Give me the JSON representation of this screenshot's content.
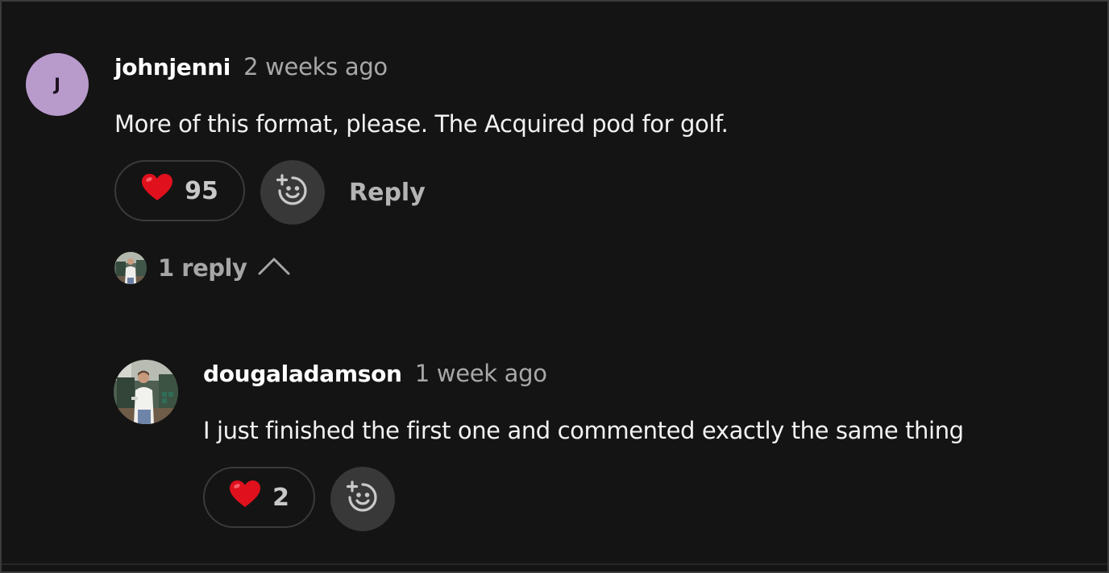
{
  "comments": [
    {
      "avatar_letter": "J",
      "avatar_color": "#b89acb",
      "username": "johnjenni",
      "timestamp": "2 weeks ago",
      "text": "More of this format, please. The Acquired pod for golf.",
      "like_emoji": "❤️",
      "like_count": "95",
      "reply_label": "Reply",
      "replies_toggle": {
        "label": "1 reply",
        "icon": "chevron-up-icon"
      }
    }
  ],
  "reply": {
    "avatar": "profile-photo",
    "username": "dougaladamson",
    "timestamp": "1 week ago",
    "text": "I just finished the first one and commented exactly the same thing",
    "like_emoji": "❤️",
    "like_count": "2"
  },
  "icons": {
    "add_reaction": "add-reaction-smiley-icon",
    "heart": "heart-emoji"
  },
  "colors": {
    "background": "#141414",
    "border": "#3b3b3b",
    "reaction_button": "#383838",
    "muted_text": "#a8a8a8"
  }
}
